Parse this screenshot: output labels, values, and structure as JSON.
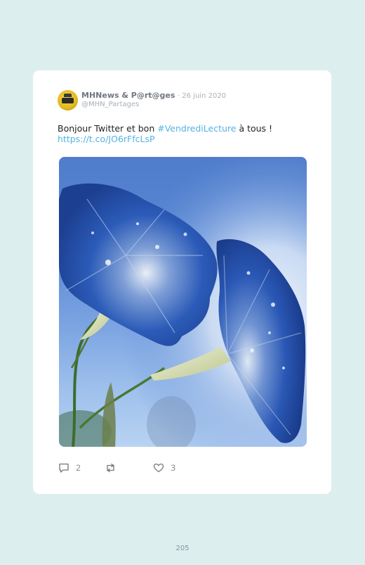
{
  "tweet": {
    "author_name": "MHNews & P@rt@ges",
    "date": "· 26 juin 2020",
    "handle": "@MHN_Partages",
    "avatar_icon": "mhnews-logo-icon",
    "text_before": "Bonjour Twitter et bon ",
    "hashtag": "#VendrediLecture",
    "text_after": " à tous !",
    "link": "https://t.co/JO6rFfcLsP",
    "image_alt": "two blue morning glory flowers with dew drops against a blue sky",
    "actions": {
      "reply_icon": "reply-icon",
      "reply_count": "2",
      "retweet_icon": "retweet-icon",
      "like_icon": "heart-icon",
      "like_count": "3"
    }
  },
  "page": {
    "number": "205"
  },
  "colors": {
    "background": "#dcefee",
    "card": "#ffffff",
    "link": "#54b3e4",
    "muted": "#a9b0b6"
  }
}
